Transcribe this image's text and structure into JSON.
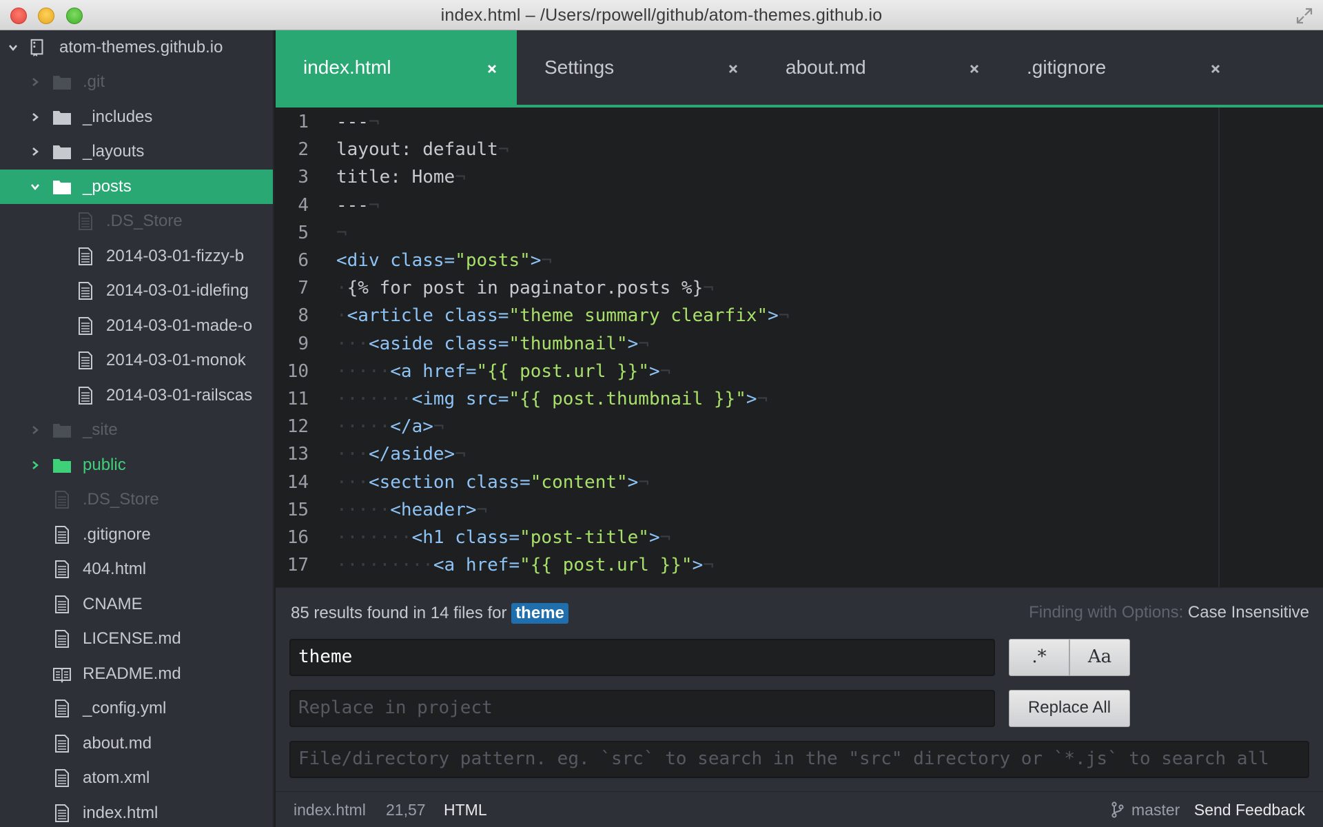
{
  "window": {
    "title": "index.html – /Users/rpowell/github/atom-themes.github.io"
  },
  "tree": {
    "root_label": "atom-themes.github.io",
    "items": [
      {
        "label": ".git",
        "kind": "folder",
        "state": "faded",
        "expanded": false
      },
      {
        "label": "_includes",
        "kind": "folder",
        "state": "normal",
        "expanded": false
      },
      {
        "label": "_layouts",
        "kind": "folder",
        "state": "normal",
        "expanded": false
      },
      {
        "label": "_posts",
        "kind": "folder",
        "state": "selected",
        "expanded": true
      },
      {
        "label": ".DS_Store",
        "kind": "file",
        "state": "faded",
        "indent": 2
      },
      {
        "label": "2014-03-01-fizzy-b",
        "kind": "file",
        "state": "normal",
        "indent": 2
      },
      {
        "label": "2014-03-01-idlefing",
        "kind": "file",
        "state": "normal",
        "indent": 2
      },
      {
        "label": "2014-03-01-made-o",
        "kind": "file",
        "state": "normal",
        "indent": 2
      },
      {
        "label": "2014-03-01-monok",
        "kind": "file",
        "state": "normal",
        "indent": 2
      },
      {
        "label": "2014-03-01-railscas",
        "kind": "file",
        "state": "normal",
        "indent": 2
      },
      {
        "label": "_site",
        "kind": "folder",
        "state": "faded",
        "expanded": false
      },
      {
        "label": "public",
        "kind": "folder",
        "state": "added",
        "expanded": false
      },
      {
        "label": ".DS_Store",
        "kind": "file",
        "state": "faded",
        "indent": 1
      },
      {
        "label": ".gitignore",
        "kind": "file",
        "state": "normal",
        "indent": 1
      },
      {
        "label": "404.html",
        "kind": "file",
        "state": "normal",
        "indent": 1
      },
      {
        "label": "CNAME",
        "kind": "file",
        "state": "normal",
        "indent": 1
      },
      {
        "label": "LICENSE.md",
        "kind": "file",
        "state": "normal",
        "indent": 1
      },
      {
        "label": "README.md",
        "kind": "book",
        "state": "normal",
        "indent": 1
      },
      {
        "label": "_config.yml",
        "kind": "file",
        "state": "normal",
        "indent": 1
      },
      {
        "label": "about.md",
        "kind": "file",
        "state": "normal",
        "indent": 1
      },
      {
        "label": "atom.xml",
        "kind": "file",
        "state": "normal",
        "indent": 1
      },
      {
        "label": "index.html",
        "kind": "file",
        "state": "normal",
        "indent": 1
      }
    ]
  },
  "tabs": [
    {
      "title": "index.html",
      "active": true
    },
    {
      "title": "Settings",
      "active": false
    },
    {
      "title": "about.md",
      "active": false
    },
    {
      "title": ".gitignore",
      "active": false
    }
  ],
  "editor": {
    "lines": [
      {
        "n": "1",
        "ws": "",
        "segs": [
          [
            "t",
            "---"
          ]
        ]
      },
      {
        "n": "2",
        "ws": "",
        "segs": [
          [
            "t",
            "layout: default"
          ]
        ]
      },
      {
        "n": "3",
        "ws": "",
        "segs": [
          [
            "t",
            "title: Home"
          ]
        ]
      },
      {
        "n": "4",
        "ws": "",
        "segs": [
          [
            "t",
            "---"
          ]
        ]
      },
      {
        "n": "5",
        "ws": "",
        "segs": []
      },
      {
        "n": "6",
        "ws": "",
        "segs": [
          [
            "g",
            "<div class="
          ],
          [
            "s",
            "\"posts\""
          ],
          [
            "g",
            ">"
          ]
        ]
      },
      {
        "n": "7",
        "ws": "·",
        "segs": [
          [
            "t",
            "{% for post in paginator.posts %}"
          ]
        ]
      },
      {
        "n": "8",
        "ws": "·",
        "segs": [
          [
            "g",
            "<article class="
          ],
          [
            "s",
            "\"theme summary clearfix\""
          ],
          [
            "g",
            ">"
          ]
        ]
      },
      {
        "n": "9",
        "ws": "···",
        "segs": [
          [
            "g",
            "<aside class="
          ],
          [
            "s",
            "\"thumbnail\""
          ],
          [
            "g",
            ">"
          ]
        ]
      },
      {
        "n": "10",
        "ws": "·····",
        "segs": [
          [
            "g",
            "<a href="
          ],
          [
            "s",
            "\"{{ post.url }}\""
          ],
          [
            "g",
            ">"
          ]
        ]
      },
      {
        "n": "11",
        "ws": "·······",
        "segs": [
          [
            "g",
            "<img src="
          ],
          [
            "s",
            "\"{{ post.thumbnail }}\""
          ],
          [
            "g",
            ">"
          ]
        ]
      },
      {
        "n": "12",
        "ws": "·····",
        "segs": [
          [
            "g",
            "</a>"
          ]
        ]
      },
      {
        "n": "13",
        "ws": "···",
        "segs": [
          [
            "g",
            "</aside>"
          ]
        ]
      },
      {
        "n": "14",
        "ws": "···",
        "segs": [
          [
            "g",
            "<section class="
          ],
          [
            "s",
            "\"content\""
          ],
          [
            "g",
            ">"
          ]
        ]
      },
      {
        "n": "15",
        "ws": "·····",
        "segs": [
          [
            "g",
            "<header>"
          ]
        ]
      },
      {
        "n": "16",
        "ws": "·······",
        "segs": [
          [
            "g",
            "<h1 class="
          ],
          [
            "s",
            "\"post-title\""
          ],
          [
            "g",
            ">"
          ]
        ]
      },
      {
        "n": "17",
        "ws": "·········",
        "segs": [
          [
            "g",
            "<a href="
          ],
          [
            "s",
            "\"{{ post.url }}\""
          ],
          [
            "g",
            ">"
          ]
        ]
      }
    ],
    "invisible_eol": "¬"
  },
  "find": {
    "results_prefix": "85 results found in 14 files for",
    "results_term": "theme",
    "options_label": "Finding with Options:",
    "options_value": "Case Insensitive",
    "find_value": "theme",
    "replace_placeholder": "Replace in project",
    "paths_placeholder": "File/directory pattern. eg. `src` to search in the \"src\" directory or `*.js` to search all",
    "regex_label": ".*",
    "case_label": "Aa",
    "replace_all_label": "Replace All"
  },
  "status": {
    "file": "index.html",
    "cursor": "21,57",
    "grammar": "HTML",
    "branch": "master",
    "feedback": "Send Feedback"
  },
  "colors": {
    "accent": "#2aa874",
    "panel": "#2d3036",
    "editor_bg": "#1e1f21",
    "tag": "#8ec3f5",
    "string": "#a8e06a",
    "added": "#3fd17a"
  }
}
